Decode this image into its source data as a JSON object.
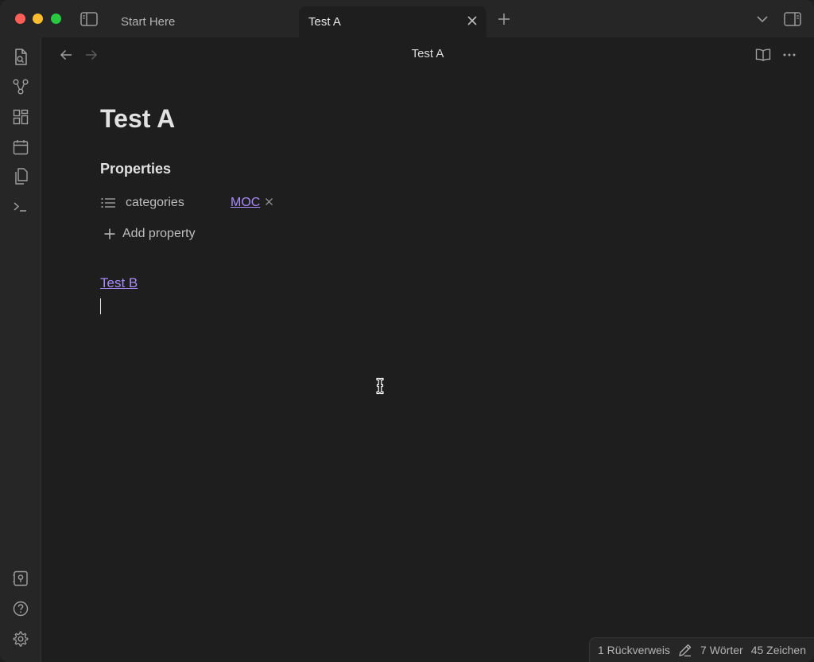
{
  "tabs": [
    {
      "label": "Start Here",
      "active": false
    },
    {
      "label": "Test A",
      "active": true
    }
  ],
  "view": {
    "title": "Test A"
  },
  "note": {
    "title": "Test A",
    "properties_heading": "Properties",
    "properties": [
      {
        "key": "categories",
        "value": "MOC",
        "icon": "list-icon"
      }
    ],
    "add_property_label": "Add property",
    "link": "Test B"
  },
  "status": {
    "backlinks": "1 Rückverweis",
    "words": "7 Wörter",
    "chars": "45 Zeichen"
  },
  "colors": {
    "accent_link": "#a88bfa",
    "background": "#1e1e1e",
    "chrome": "#262626"
  }
}
